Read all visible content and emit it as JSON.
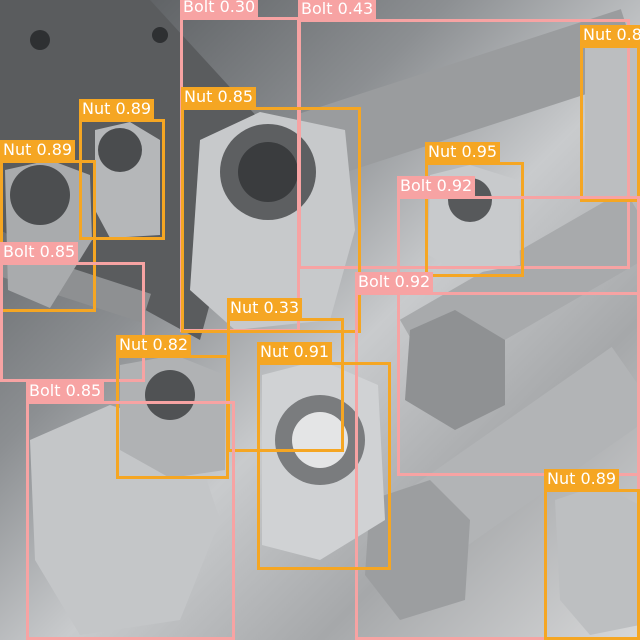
{
  "image": {
    "subject": "stainless steel nuts and bolts",
    "color_palette": "grayscale"
  },
  "colors": {
    "bolt": "#f7a3a3",
    "nut": "#f5a623",
    "label_text": "#ffffff"
  },
  "detections": [
    {
      "label": "Bolt 0.30"
    },
    {
      "label": "Bolt 0.43"
    },
    {
      "label": "Nut 0.8"
    },
    {
      "label": "Nut 0.89"
    },
    {
      "label": "Nut 0.85"
    },
    {
      "label": "Nut 0.89"
    },
    {
      "label": "Nut 0.95"
    },
    {
      "label": "Bolt 0.92"
    },
    {
      "label": "Bolt 0.85"
    },
    {
      "label": "Bolt 0.92"
    },
    {
      "label": "Nut 0.33"
    },
    {
      "label": "Nut 0.82"
    },
    {
      "label": "Nut 0.91"
    },
    {
      "label": "Bolt 0.85"
    },
    {
      "label": "Nut 0.89"
    }
  ]
}
